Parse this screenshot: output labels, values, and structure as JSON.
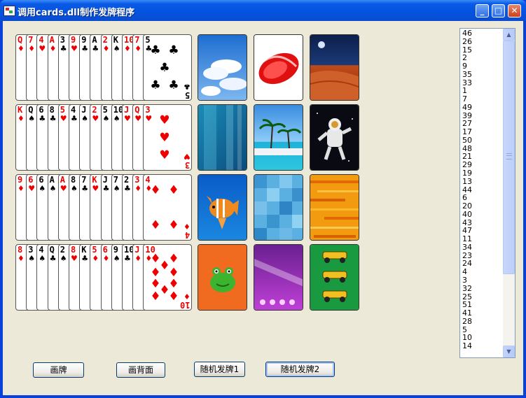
{
  "window": {
    "title": "调用cards.dll制作发牌程序"
  },
  "titlebar_buttons": [
    "minimize",
    "maximize",
    "close"
  ],
  "card_rows": [
    [
      {
        "rank": "Q",
        "suit": "♦",
        "color": "red"
      },
      {
        "rank": "7",
        "suit": "♦",
        "color": "red"
      },
      {
        "rank": "4",
        "suit": "♥",
        "color": "red"
      },
      {
        "rank": "A",
        "suit": "♦",
        "color": "red"
      },
      {
        "rank": "3",
        "suit": "♣",
        "color": "black"
      },
      {
        "rank": "9",
        "suit": "♥",
        "color": "red"
      },
      {
        "rank": "9",
        "suit": "♣",
        "color": "black"
      },
      {
        "rank": "A",
        "suit": "♣",
        "color": "black"
      },
      {
        "rank": "2",
        "suit": "♦",
        "color": "red"
      },
      {
        "rank": "K",
        "suit": "♠",
        "color": "black"
      },
      {
        "rank": "10",
        "suit": "♦",
        "color": "red"
      },
      {
        "rank": "7",
        "suit": "♦",
        "color": "red"
      },
      {
        "rank": "5",
        "suit": "♣",
        "color": "black"
      }
    ],
    [
      {
        "rank": "K",
        "suit": "♦",
        "color": "red"
      },
      {
        "rank": "Q",
        "suit": "♠",
        "color": "black"
      },
      {
        "rank": "6",
        "suit": "♣",
        "color": "black"
      },
      {
        "rank": "8",
        "suit": "♣",
        "color": "black"
      },
      {
        "rank": "5",
        "suit": "♥",
        "color": "red"
      },
      {
        "rank": "4",
        "suit": "♣",
        "color": "black"
      },
      {
        "rank": "J",
        "suit": "♠",
        "color": "black"
      },
      {
        "rank": "2",
        "suit": "♥",
        "color": "red"
      },
      {
        "rank": "5",
        "suit": "♠",
        "color": "black"
      },
      {
        "rank": "10",
        "suit": "♠",
        "color": "black"
      },
      {
        "rank": "J",
        "suit": "♥",
        "color": "red"
      },
      {
        "rank": "Q",
        "suit": "♥",
        "color": "red"
      },
      {
        "rank": "3",
        "suit": "♥",
        "color": "red"
      }
    ],
    [
      {
        "rank": "9",
        "suit": "♦",
        "color": "red"
      },
      {
        "rank": "6",
        "suit": "♥",
        "color": "red"
      },
      {
        "rank": "6",
        "suit": "♠",
        "color": "black"
      },
      {
        "rank": "A",
        "suit": "♠",
        "color": "black"
      },
      {
        "rank": "A",
        "suit": "♥",
        "color": "red"
      },
      {
        "rank": "8",
        "suit": "♠",
        "color": "black"
      },
      {
        "rank": "7",
        "suit": "♣",
        "color": "black"
      },
      {
        "rank": "K",
        "suit": "♥",
        "color": "red"
      },
      {
        "rank": "J",
        "suit": "♣",
        "color": "black"
      },
      {
        "rank": "7",
        "suit": "♠",
        "color": "black"
      },
      {
        "rank": "2",
        "suit": "♣",
        "color": "black"
      },
      {
        "rank": "3",
        "suit": "♦",
        "color": "red"
      },
      {
        "rank": "4",
        "suit": "♦",
        "color": "red"
      }
    ],
    [
      {
        "rank": "8",
        "suit": "♦",
        "color": "red"
      },
      {
        "rank": "3",
        "suit": "♠",
        "color": "black"
      },
      {
        "rank": "4",
        "suit": "♠",
        "color": "black"
      },
      {
        "rank": "Q",
        "suit": "♣",
        "color": "black"
      },
      {
        "rank": "2",
        "suit": "♠",
        "color": "black"
      },
      {
        "rank": "8",
        "suit": "♥",
        "color": "red"
      },
      {
        "rank": "K",
        "suit": "♣",
        "color": "black"
      },
      {
        "rank": "5",
        "suit": "♦",
        "color": "red"
      },
      {
        "rank": "6",
        "suit": "♦",
        "color": "red"
      },
      {
        "rank": "9",
        "suit": "♠",
        "color": "black"
      },
      {
        "rank": "10",
        "suit": "♣",
        "color": "black"
      },
      {
        "rank": "J",
        "suit": "♦",
        "color": "red"
      },
      {
        "rank": "10",
        "suit": "♦",
        "color": "red"
      }
    ]
  ],
  "card_backs": [
    [
      "sky-clouds",
      "red-swirl",
      "desert-moon"
    ],
    [
      "aqua-glass",
      "tropical-beach",
      "astronaut"
    ],
    [
      "tropical-fish",
      "blue-squares",
      "orange-stripes"
    ],
    [
      "frog",
      "purple-lights",
      "race-cars"
    ]
  ],
  "listbox": {
    "items": [
      "46",
      "26",
      "15",
      "2",
      "9",
      "35",
      "33",
      "1",
      "7",
      "49",
      "39",
      "27",
      "17",
      "50",
      "48",
      "21",
      "29",
      "19",
      "13",
      "44",
      "6",
      "20",
      "40",
      "43",
      "47",
      "11",
      "34",
      "23",
      "24",
      "4",
      "3",
      "32",
      "25",
      "51",
      "41",
      "28",
      "5",
      "10",
      "14"
    ]
  },
  "buttons": {
    "draw_cards": "画牌",
    "draw_backs": "画背面",
    "random_deal_1": "随机发牌1",
    "random_deal_2": "随机发牌2"
  },
  "colors": {
    "title_blue": "#0453E0",
    "face": "#ECE9D8",
    "red_suit": "#e00000"
  }
}
